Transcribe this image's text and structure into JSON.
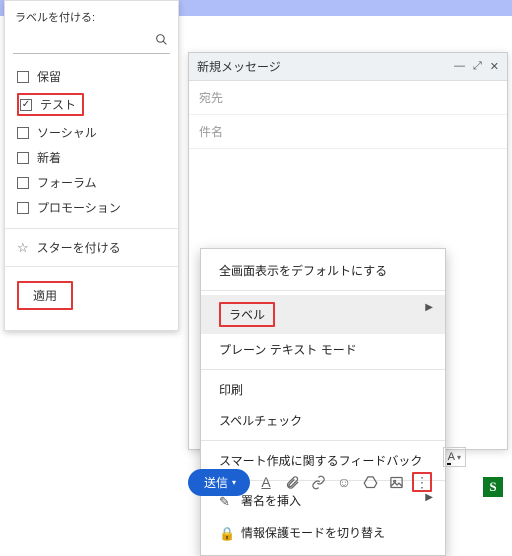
{
  "label_panel": {
    "title": "ラベルを付ける:",
    "search_placeholder": "",
    "items": [
      {
        "label": "保留",
        "checked": false
      },
      {
        "label": "テスト",
        "checked": true
      },
      {
        "label": "ソーシャル",
        "checked": false
      },
      {
        "label": "新着",
        "checked": false
      },
      {
        "label": "フォーラム",
        "checked": false
      },
      {
        "label": "プロモーション",
        "checked": false
      }
    ],
    "star_label": "スターを付ける",
    "apply_label": "適用"
  },
  "compose": {
    "title": "新規メッセージ",
    "to_placeholder": "宛先",
    "subject_placeholder": "件名"
  },
  "context_menu": {
    "items": {
      "fullscreen": "全画面表示をデフォルトにする",
      "label": "ラベル",
      "plaintext": "プレーン テキスト モード",
      "print": "印刷",
      "spellcheck": "スペルチェック",
      "smartcompose": "スマート作成に関するフィードバック",
      "signature": "署名を挿入",
      "confidential": "情報保護モードを切り替え"
    }
  },
  "toolbar": {
    "send_label": "送信",
    "font_label": "A"
  },
  "badge": {
    "text": "S"
  },
  "colors": {
    "accent": "#1b61d1",
    "highlight": "#e33636"
  }
}
